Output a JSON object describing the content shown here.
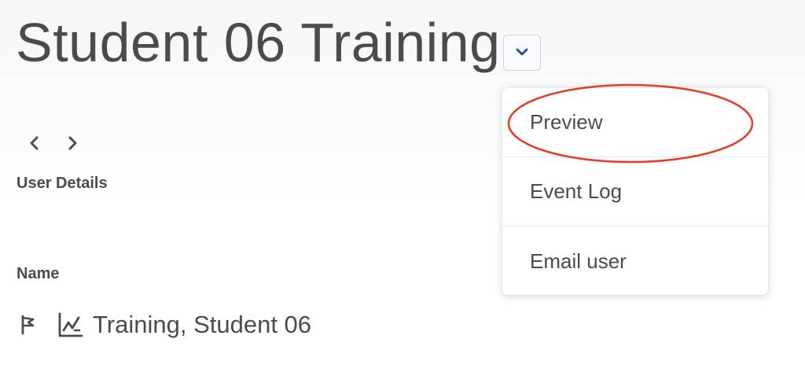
{
  "header": {
    "title": "Student 06 Training",
    "dropdown_icon": "chevron-down-icon"
  },
  "navigation": {
    "prev_icon": "chevron-left-icon",
    "next_icon": "chevron-right-icon"
  },
  "section": {
    "title": "User Details"
  },
  "name_field": {
    "label": "Name",
    "value": "Training, Student 06",
    "icons": [
      "flag-icon",
      "chart-icon"
    ]
  },
  "menu": {
    "items": [
      {
        "label": "Preview"
      },
      {
        "label": "Event Log"
      },
      {
        "label": "Email user"
      }
    ]
  },
  "colors": {
    "text": "#494c4e",
    "accent": "#006fbf",
    "annotation": "#e0412a",
    "divider": "#e3e9f1"
  }
}
